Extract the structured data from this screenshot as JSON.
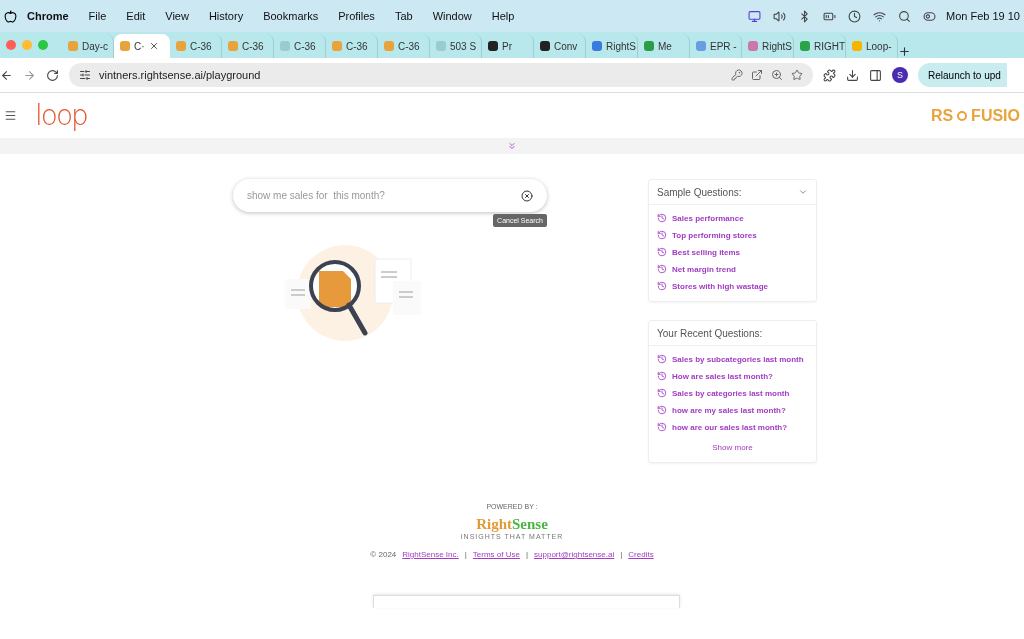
{
  "menu_bar": {
    "app": "Chrome",
    "menus": [
      "File",
      "Edit",
      "View",
      "History",
      "Bookmarks",
      "Profiles",
      "Tab",
      "Window",
      "Help"
    ],
    "clock": "Mon Feb 19 10"
  },
  "tabs": [
    {
      "label": "Day-c",
      "selected": false
    },
    {
      "label": "C·",
      "selected": true
    },
    {
      "label": "C-36",
      "selected": false
    },
    {
      "label": "C-36",
      "selected": false
    },
    {
      "label": "C-36",
      "selected": false
    },
    {
      "label": "C-36",
      "selected": false
    },
    {
      "label": "C-36",
      "selected": false
    },
    {
      "label": "503 S",
      "selected": false
    },
    {
      "label": "Pr",
      "selected": false
    },
    {
      "label": "Conv",
      "selected": false
    },
    {
      "label": "RightS",
      "selected": false
    },
    {
      "label": "Me",
      "selected": false
    },
    {
      "label": "EPR -",
      "selected": false
    },
    {
      "label": "RightS",
      "selected": false
    },
    {
      "label": "RIGHT",
      "selected": false
    },
    {
      "label": "Loop-",
      "selected": false
    }
  ],
  "address_bar": {
    "url": "vintners.rightsense.ai/playground",
    "profile": "S",
    "relaunch": "Relaunch to upd"
  },
  "header": {
    "logo": "loop",
    "brand_left": "RS",
    "brand_right": "FUSIO"
  },
  "search": {
    "value": "show me sales for  this month?",
    "tooltip": "Cancel Search"
  },
  "sample_questions": {
    "title": "Sample Questions:",
    "items": [
      "Sales performance",
      "Top performing stores",
      "Best selling items",
      "Net margin trend",
      "Stores with high wastage"
    ]
  },
  "recent_questions": {
    "title": "Your Recent Questions:",
    "items": [
      "Sales by subcategories last month",
      "How are sales last month?",
      "Sales by categories last month",
      "how are my sales last month?",
      "how are our sales last month?"
    ],
    "more": "Show more"
  },
  "footer": {
    "powered_by": "POWERED BY :",
    "brand": [
      "Right",
      "Sense"
    ],
    "tagline": "INSIGHTS THAT MATTER",
    "copyright": "© 2024",
    "links": [
      "RightSense Inc.",
      "Terms of Use",
      "support@rightsense.ai",
      "Credits"
    ],
    "separators": [
      "|",
      "|",
      "|"
    ]
  }
}
